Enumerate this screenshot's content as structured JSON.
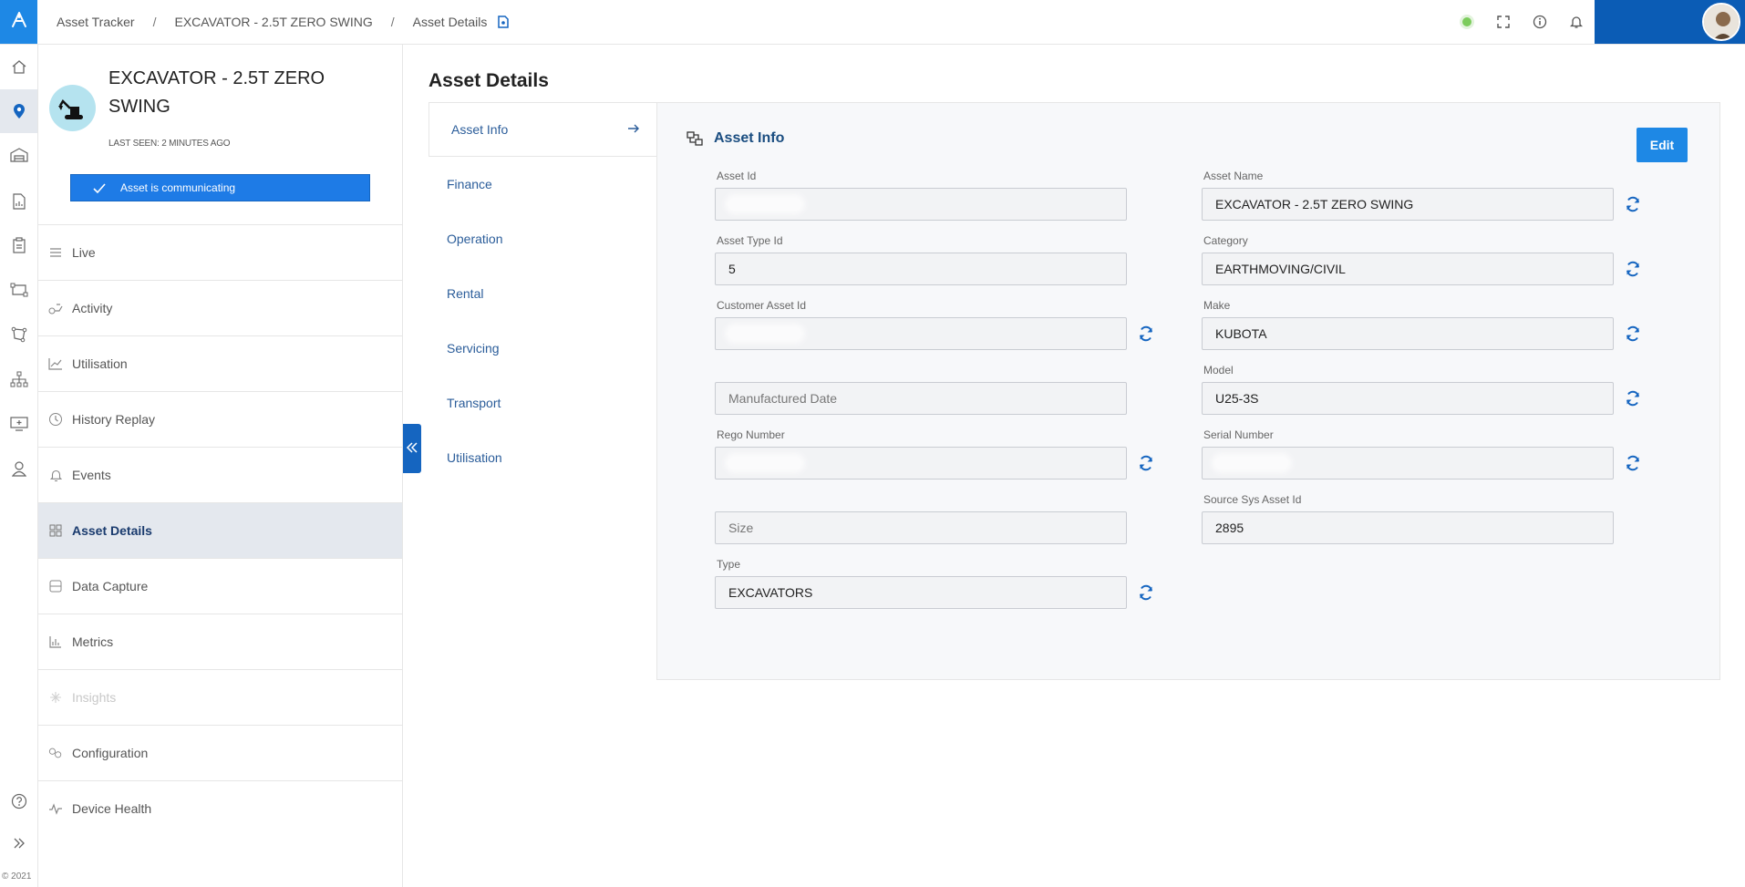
{
  "breadcrumb": {
    "items": [
      "Asset Tracker",
      "EXCAVATOR - 2.5T ZERO SWING",
      "Asset Details"
    ],
    "separator": "/"
  },
  "colors": {
    "accent": "#1e88e5",
    "brand_dark": "#0b5cb5",
    "status_online": "#7ccc5c"
  },
  "asset": {
    "title": "EXCAVATOR - 2.5T ZERO SWING",
    "last_seen": "LAST SEEN: 2 MINUTES AGO",
    "comm_status": "Asset is communicating"
  },
  "menu": [
    {
      "label": "Live",
      "icon": "list-icon",
      "active": false,
      "disabled": false
    },
    {
      "label": "Activity",
      "icon": "activity-icon",
      "active": false,
      "disabled": false
    },
    {
      "label": "Utilisation",
      "icon": "line-chart-icon",
      "active": false,
      "disabled": false
    },
    {
      "label": "History Replay",
      "icon": "clock-icon",
      "active": false,
      "disabled": false
    },
    {
      "label": "Events",
      "icon": "bell-icon",
      "active": false,
      "disabled": false
    },
    {
      "label": "Asset Details",
      "icon": "grid-icon",
      "active": true,
      "disabled": false
    },
    {
      "label": "Data Capture",
      "icon": "database-icon",
      "active": false,
      "disabled": false
    },
    {
      "label": "Metrics",
      "icon": "bar-chart-icon",
      "active": false,
      "disabled": false
    },
    {
      "label": "Insights",
      "icon": "sparkle-icon",
      "active": false,
      "disabled": true
    },
    {
      "label": "Configuration",
      "icon": "gears-icon",
      "active": false,
      "disabled": false
    },
    {
      "label": "Device Health",
      "icon": "heartbeat-icon",
      "active": false,
      "disabled": false
    }
  ],
  "rail_copyright": "© 2021",
  "main": {
    "title": "Asset Details",
    "tabs": [
      "Asset Info",
      "Finance",
      "Operation",
      "Rental",
      "Servicing",
      "Transport",
      "Utilisation"
    ],
    "active_tab": "Asset Info"
  },
  "card": {
    "heading": "Asset Info",
    "edit_label": "Edit",
    "left_fields": [
      {
        "label": "Asset Id",
        "value": "",
        "placeholder": "",
        "redacted": true,
        "sync": false
      },
      {
        "label": "Asset Type Id",
        "value": "5",
        "placeholder": "",
        "redacted": false,
        "sync": false
      },
      {
        "label": "Customer Asset Id",
        "value": "",
        "placeholder": "",
        "redacted": true,
        "sync": true
      },
      {
        "label": "",
        "value": "",
        "placeholder": "Manufactured Date",
        "redacted": false,
        "sync": false
      },
      {
        "label": "Rego Number",
        "value": "",
        "placeholder": "",
        "redacted": true,
        "sync": true
      },
      {
        "label": "",
        "value": "",
        "placeholder": "Size",
        "redacted": false,
        "sync": false
      },
      {
        "label": "Type",
        "value": "EXCAVATORS",
        "placeholder": "",
        "redacted": false,
        "sync": true
      }
    ],
    "right_fields": [
      {
        "label": "Asset Name",
        "value": "EXCAVATOR -  2.5T ZERO SWING",
        "placeholder": "",
        "redacted": false,
        "sync": true
      },
      {
        "label": "Category",
        "value": "EARTHMOVING/CIVIL",
        "placeholder": "",
        "redacted": false,
        "sync": true
      },
      {
        "label": "Make",
        "value": "KUBOTA",
        "placeholder": "",
        "redacted": false,
        "sync": true
      },
      {
        "label": "Model",
        "value": "U25-3S",
        "placeholder": "",
        "redacted": false,
        "sync": true
      },
      {
        "label": "Serial Number",
        "value": "",
        "placeholder": "",
        "redacted": true,
        "sync": true
      },
      {
        "label": "Source Sys Asset Id",
        "value": "2895",
        "placeholder": "",
        "redacted": false,
        "sync": false
      }
    ]
  }
}
